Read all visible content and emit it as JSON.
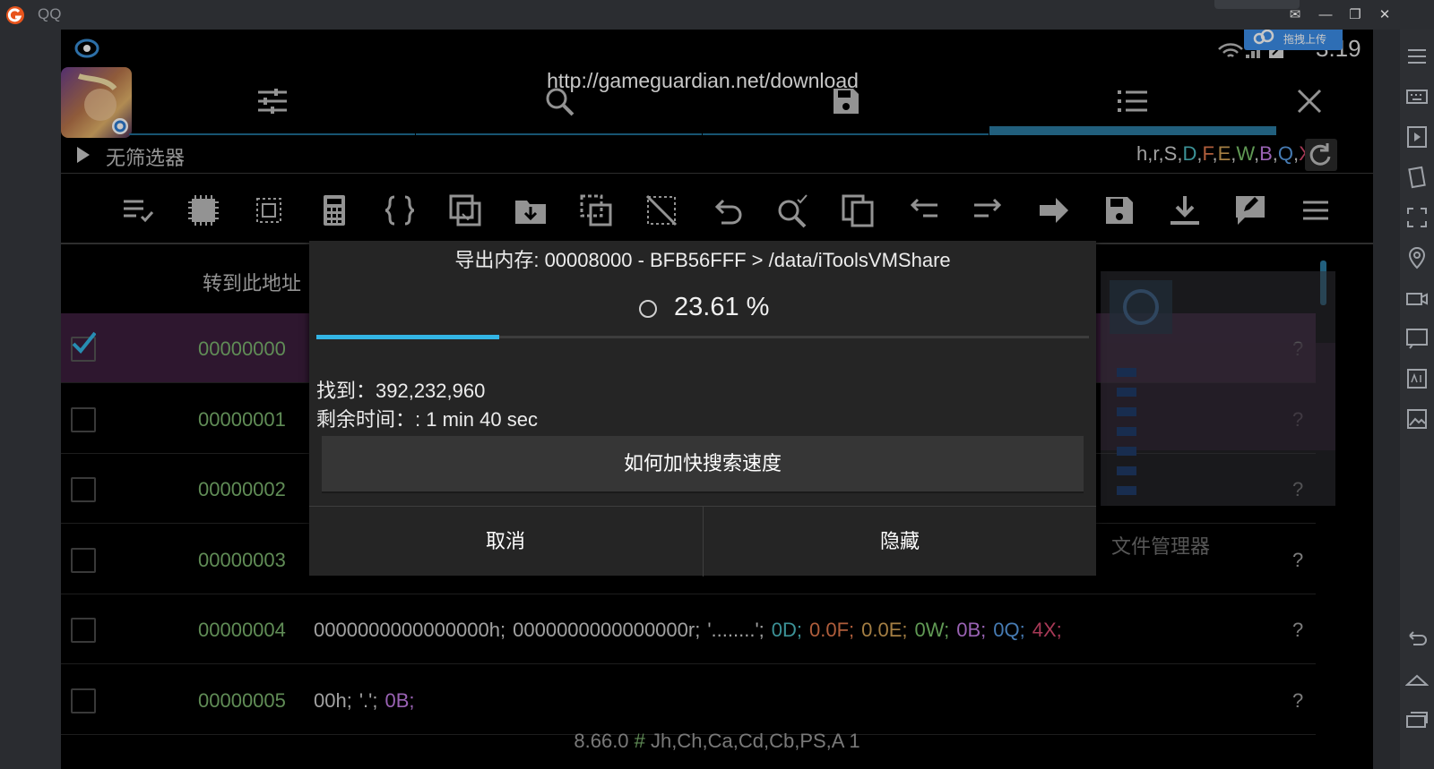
{
  "host": {
    "title": "QQ",
    "window_buttons": [
      "minimize",
      "restore",
      "close"
    ]
  },
  "status": {
    "time": "3:19",
    "upload_badge": "拖拽上传"
  },
  "url": "http://gameguardian.net/download",
  "tabs": [
    {
      "icon": "sliders-icon",
      "active": false
    },
    {
      "icon": "search-icon",
      "active": false
    },
    {
      "icon": "save-icon",
      "active": false
    },
    {
      "icon": "list-icon",
      "active": true
    }
  ],
  "filter": {
    "label": "无筛选器",
    "types": [
      {
        "t": "h",
        "color": "#cfcfcf"
      },
      {
        "t": "r",
        "color": "#cfcfcf"
      },
      {
        "t": "S",
        "color": "#cfcfcf"
      },
      {
        "t": "D",
        "color": "#4dbcc2"
      },
      {
        "t": "F",
        "color": "#e0784c"
      },
      {
        "t": "E",
        "color": "#d3a257"
      },
      {
        "t": "W",
        "color": "#7bc56c"
      },
      {
        "t": "B",
        "color": "#c57ee6"
      },
      {
        "t": "Q",
        "color": "#5a9ee6"
      },
      {
        "t": "X",
        "color": "#d6496f"
      }
    ]
  },
  "toolbar_icons": [
    "select-all-icon",
    "chip-icon",
    "chip-outline-icon",
    "calculator-icon",
    "braces-icon",
    "copy-region-icon",
    "folder-download-icon",
    "offset-icon",
    "deselect-icon",
    "undo-icon",
    "search-check-icon",
    "copy-icon",
    "arrow-left-icon",
    "arrow-right-icon",
    "arrow-forward-icon",
    "save-icon",
    "download-icon",
    "edit-comment-icon",
    "menu-icon"
  ],
  "list": {
    "goto_label": "转到此地址",
    "rows": [
      {
        "addr": "00000000",
        "checked": true,
        "q": "?"
      },
      {
        "addr": "00000001",
        "checked": false,
        "q": "?"
      },
      {
        "addr": "00000002",
        "checked": false,
        "q": "?"
      },
      {
        "addr": "00000003",
        "checked": false,
        "q": "?"
      },
      {
        "addr": "00000004",
        "checked": false,
        "q": "?"
      },
      {
        "addr": "00000005",
        "checked": false,
        "q": "?"
      }
    ],
    "row4_values": [
      {
        "t": "0000000000000000h;",
        "color": "#cfcfcf"
      },
      {
        "t": "0000000000000000r;",
        "color": "#cfcfcf"
      },
      {
        "t": "'........';",
        "color": "#cfcfcf"
      },
      {
        "t": "0D;",
        "color": "#4dbcc2"
      },
      {
        "t": "0.0F;",
        "color": "#e0784c"
      },
      {
        "t": "0.0E;",
        "color": "#d3a257"
      },
      {
        "t": "0W;",
        "color": "#7bc56c"
      },
      {
        "t": "0B;",
        "color": "#c57ee6"
      },
      {
        "t": "0Q;",
        "color": "#5a9ee6"
      },
      {
        "t": "4X;",
        "color": "#d6496f"
      }
    ],
    "row5_values": [
      {
        "t": "00h;",
        "color": "#cfcfcf"
      },
      {
        "t": "'.';",
        "color": "#cfcfcf"
      },
      {
        "t": "0B;",
        "color": "#c57ee6"
      }
    ]
  },
  "footer": {
    "version": "8.66.0",
    "hash": "#",
    "flags": "Jh,Ch,Ca,Cd,Cb,PS,A 1"
  },
  "ghost_label": "文件管理器",
  "dialog": {
    "title": "导出内存: 00008000 - BFB56FFF > /data/iToolsVMShare",
    "percent": "23.61 %",
    "progress": 0.2361,
    "found": "找到：392,232,960",
    "remaining": "剩余时间：: 1 min 40 sec",
    "speedup": "如何加快搜索速度",
    "cancel": "取消",
    "hide": "隐藏"
  }
}
